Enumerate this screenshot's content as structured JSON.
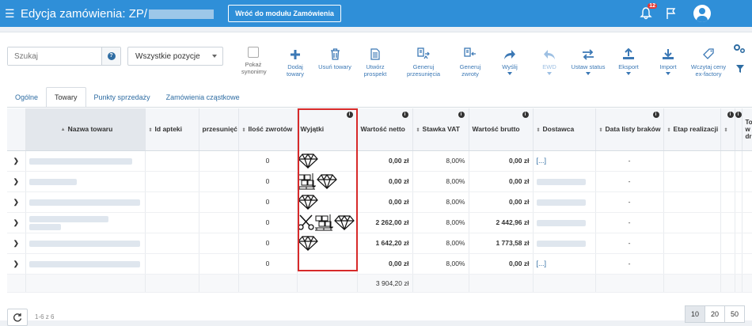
{
  "header": {
    "title": "Edycja zamówienia: ZP/",
    "back_button": "Wróć do modułu Zamówienia",
    "notification_count": "12"
  },
  "toolbar": {
    "search_placeholder": "Szukaj",
    "filter_value": "Wszystkie pozycje",
    "synonyms_label": "Pokaż synonimy",
    "buttons": [
      {
        "label": "Dodaj towary",
        "icon": "plus-icon",
        "disabled": false,
        "dropdown": false
      },
      {
        "label": "Usuń towary",
        "icon": "trash-icon",
        "disabled": false,
        "dropdown": false
      },
      {
        "label": "Utwórz prospekt",
        "icon": "document-icon",
        "disabled": false,
        "dropdown": false
      },
      {
        "label": "Generuj przesunięcia",
        "icon": "transfer-icon",
        "disabled": false,
        "dropdown": false
      },
      {
        "label": "Generuj zwroty",
        "icon": "return-icon",
        "disabled": false,
        "dropdown": false
      },
      {
        "label": "Wyślij",
        "icon": "send-icon",
        "disabled": false,
        "dropdown": true
      },
      {
        "label": "EWD",
        "icon": "undo-icon",
        "disabled": true,
        "dropdown": true
      },
      {
        "label": "Ustaw status",
        "icon": "swap-icon",
        "disabled": false,
        "dropdown": true
      },
      {
        "label": "Eksport",
        "icon": "export-icon",
        "disabled": false,
        "dropdown": true
      },
      {
        "label": "Import",
        "icon": "import-icon",
        "disabled": false,
        "dropdown": true
      },
      {
        "label": "Wczytaj ceny ex-factory",
        "icon": "tag-icon",
        "disabled": false,
        "dropdown": false
      }
    ]
  },
  "tabs": [
    {
      "label": "Ogólne",
      "active": false
    },
    {
      "label": "Towary",
      "active": true
    },
    {
      "label": "Punkty sprzedaży",
      "active": false
    },
    {
      "label": "Zamówienia cząstkowe",
      "active": false
    }
  ],
  "columns": {
    "name": "Nazwa towaru",
    "pharmacy_id": "Id apteki",
    "transfer": "przesunięć",
    "returns": "Ilość zwrotów",
    "exceptions": "Wyjątki",
    "net": "Wartość netto",
    "vat": "Stawka VAT",
    "gross": "Wartość brutto",
    "supplier": "Dostawca",
    "defects_date": "Data listy braków",
    "stage": "Etap realizacji",
    "last": "To w dr"
  },
  "rows": [
    {
      "returns": "0",
      "exceptions": [
        "diamond-icon"
      ],
      "net": "0,00 zł",
      "vat": "8,00%",
      "gross": "0,00 zł",
      "supplier": "[...]",
      "defects_date": "-",
      "zero_red": true
    },
    {
      "returns": "0",
      "exceptions": [
        "pallet-icon",
        "diamond-icon"
      ],
      "net": "0,00 zł",
      "vat": "8,00%",
      "gross": "0,00 zł",
      "supplier": "",
      "defects_date": "-",
      "zero_red": false
    },
    {
      "returns": "0",
      "exceptions": [
        "diamond-icon"
      ],
      "net": "0,00 zł",
      "vat": "8,00%",
      "gross": "0,00 zł",
      "supplier": "",
      "defects_date": "-",
      "zero_red": false
    },
    {
      "returns": "0",
      "exceptions": [
        "scissors-icon",
        "pallet-icon",
        "diamond-icon"
      ],
      "net": "2 262,00 zł",
      "vat": "8,00%",
      "gross": "2 442,96 zł",
      "supplier": "",
      "defects_date": "-",
      "zero_red": false
    },
    {
      "returns": "0",
      "exceptions": [
        "diamond-icon"
      ],
      "net": "1 642,20 zł",
      "vat": "8,00%",
      "gross": "1 773,58 zł",
      "supplier": "",
      "defects_date": "-",
      "zero_red": false
    },
    {
      "returns": "0",
      "exceptions": [],
      "net": "0,00 zł",
      "vat": "8,00%",
      "gross": "0,00 zł",
      "supplier": "[...]",
      "defects_date": "-",
      "zero_red": false
    }
  ],
  "summary": {
    "net_total": "3 904,20 zł"
  },
  "footer": {
    "range": "1-6 z 6",
    "page_sizes": [
      "10",
      "20",
      "50"
    ],
    "active_page_size": "10"
  },
  "colors": {
    "header_blue": "#2f8fd8",
    "highlight_red": "#d72a2a",
    "accent_orange": "#e0761f"
  }
}
